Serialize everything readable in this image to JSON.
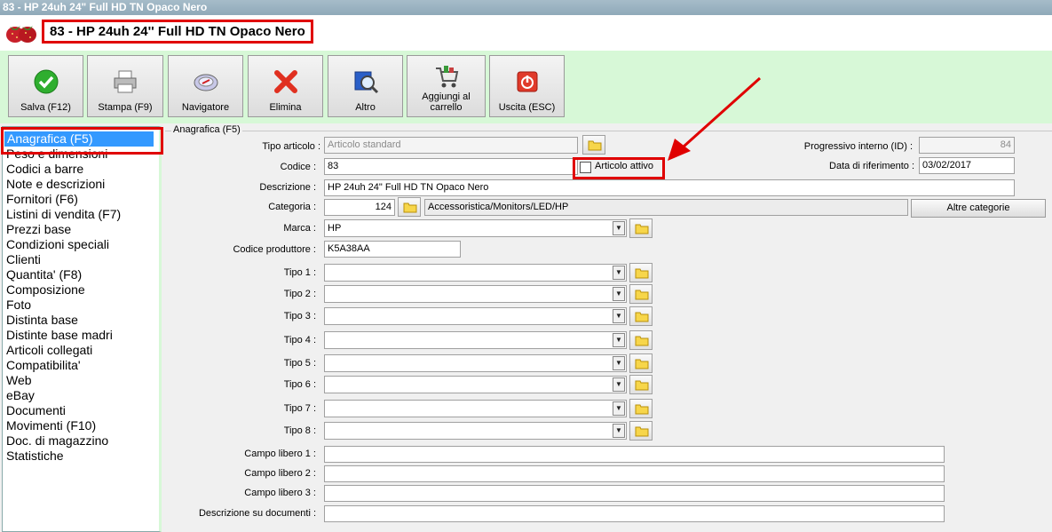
{
  "window": {
    "title": "83 - HP 24uh 24\" Full HD TN Opaco Nero"
  },
  "header": {
    "title": "83 - HP 24uh 24'' Full HD TN Opaco Nero",
    "logo": "strawberry-logo"
  },
  "toolbar": {
    "save": "Salva (F12)",
    "print": "Stampa (F9)",
    "navigator": "Navigatore",
    "delete": "Elimina",
    "other": "Altro",
    "add_cart_1": "Aggiungi al",
    "add_cart_2": "carrello",
    "exit": "Uscita (ESC)"
  },
  "sidebar": {
    "items": [
      "Anagrafica (F5)",
      "Peso e dimensioni",
      "Codici a barre",
      "Note e descrizioni",
      "Fornitori (F6)",
      "Listini di vendita (F7)",
      "Prezzi base",
      "Condizioni speciali",
      "Clienti",
      "Quantita' (F8)",
      "Composizione",
      "Foto",
      "Distinta base",
      "Distinte base madri",
      "Articoli collegati",
      "Compatibilita'",
      "Web",
      "eBay",
      "Documenti",
      "Movimenti (F10)",
      "Doc. di magazzino",
      "Statistiche"
    ],
    "selected": "Anagrafica (F5)"
  },
  "form": {
    "group_label": "Anagrafica (F5)",
    "tipo_articolo_label": "Tipo articolo :",
    "tipo_articolo_value": "Articolo standard",
    "codice_label": "Codice :",
    "codice_value": "83",
    "articolo_attivo_label": "Articolo attivo",
    "articolo_attivo_checked": false,
    "progressivo_label": "Progressivo interno (ID) :",
    "progressivo_value": "84",
    "data_rif_label": "Data di riferimento :",
    "data_rif_value": "03/02/2017",
    "descrizione_label": "Descrizione :",
    "descrizione_value": "HP 24uh 24\" Full HD TN Opaco Nero",
    "categoria_label": "Categoria :",
    "categoria_code": "124",
    "categoria_path": "Accessoristica/Monitors/LED/HP",
    "altre_categorie": "Altre categorie",
    "marca_label": "Marca :",
    "marca_value": "HP",
    "codice_produttore_label": "Codice produttore :",
    "codice_produttore_value": "K5A38AA",
    "tipo_labels": [
      "Tipo 1 :",
      "Tipo 2 :",
      "Tipo 3 :",
      "Tipo 4 :",
      "Tipo 5 :",
      "Tipo 6 :",
      "Tipo 7 :",
      "Tipo 8 :"
    ],
    "campo_libero_labels": [
      "Campo libero 1 :",
      "Campo libero 2 :",
      "Campo libero 3 :"
    ],
    "descrizione_documenti_label": "Descrizione su documenti :"
  },
  "colors": {
    "highlight": "#e00000",
    "toolbar_bg": "#d7f8d7",
    "selection": "#3399ff"
  }
}
